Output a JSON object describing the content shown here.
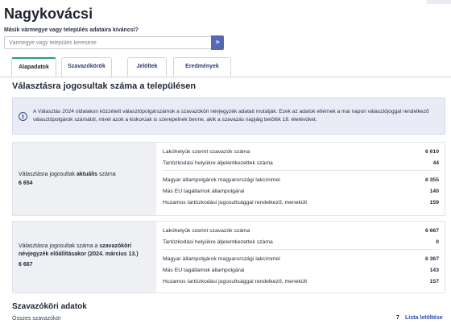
{
  "page": {
    "title": "Nagykovácsi"
  },
  "search": {
    "label": "Másik vármegye vagy település adataira kíváncsi?",
    "placeholder": "Vármegye vagy település keresése",
    "button_glyph": "»"
  },
  "tabs": [
    {
      "label": "Alapadatok",
      "active": true
    },
    {
      "label": "Szavazókörök",
      "active": false
    },
    {
      "label": "Jelöltek",
      "active": false
    },
    {
      "label": "Eredmények",
      "active": false
    }
  ],
  "section": {
    "title": "Választásra jogosultak száma a településen",
    "info_text": "A Választás 2024 oldalakon közzétett választópolgárszámok a szavazóköri névjegyzék adatait mutatják. Ezek az adatok eltérnek a mai napon választójoggal rendelkező választópolgárok számától, mivel azok a kiskorúak is szerepelnek benne, akik a szavazás napjáig betöltik 18. életévüket."
  },
  "cards": [
    {
      "label_pre": "Választásra jogosultak ",
      "label_bold": "aktuális",
      "label_post": " száma",
      "value": "6 654",
      "rows": [
        {
          "label": "Lakóhelyük szerint szavazók száma",
          "value": "6 610"
        },
        {
          "label": "Tartózkodási helyükre átjelentkezettek száma",
          "value": "44"
        },
        {
          "label": "Magyar állampolgárok magyarországi lakcímmel",
          "value": "6 355"
        },
        {
          "label": "Más EU tagállamok állampolgárai",
          "value": "140"
        },
        {
          "label": "Huzamos tartózkodási jogosultsággal rendelkező, menekült",
          "value": "159"
        }
      ]
    },
    {
      "label_pre": "Választásra jogosultak száma a ",
      "label_bold": "szavazóköri névjegyzék előállításakor (2024. március 13.)",
      "label_post": "",
      "value": "6 667",
      "rows": [
        {
          "label": "Lakóhelyük szerint szavazók száma",
          "value": "6 667"
        },
        {
          "label": "Tartózkodási helyükre átjelentkezettek száma",
          "value": "0"
        },
        {
          "label": "Magyar állampolgárok magyarországi lakcímmel",
          "value": "6 367"
        },
        {
          "label": "Más EU tagállamok állampolgárai",
          "value": "143"
        },
        {
          "label": "Huzamos tartózkodási jogosultsággal rendelkező, menekült",
          "value": "157"
        }
      ]
    }
  ],
  "precincts": {
    "title": "Szavazóköri adatok",
    "total_label": "Összes szavazókör",
    "total_value": "7",
    "link_label": "Lista letöltése"
  },
  "colors": {
    "accent": "#5368b6",
    "active_tab": "#26a07a",
    "info_bg": "#e9ecf7",
    "link": "#2d4aa8"
  }
}
